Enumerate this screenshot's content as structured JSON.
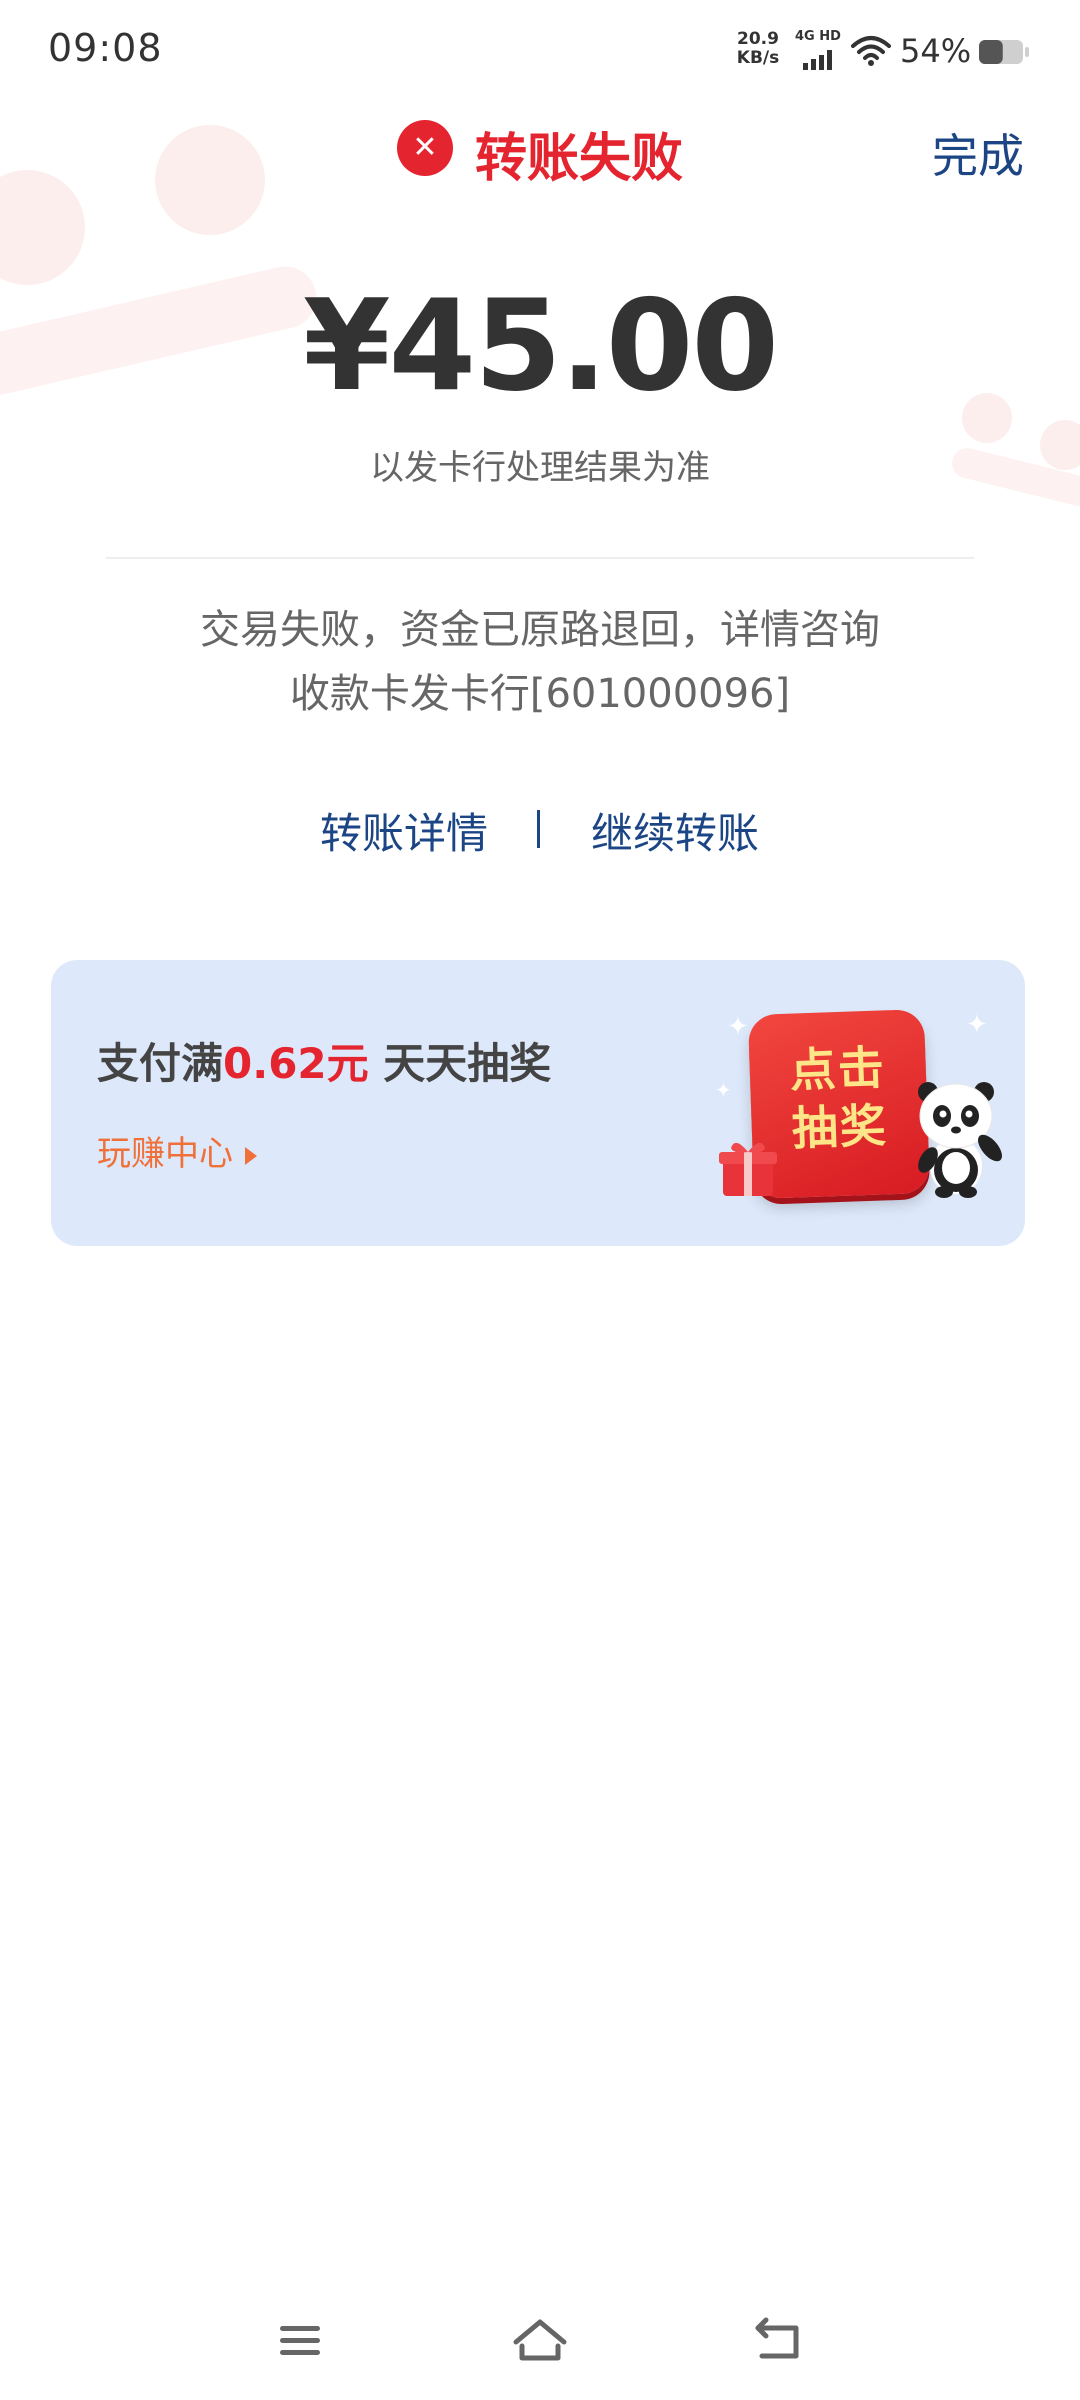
{
  "status_bar": {
    "time": "09:08",
    "net_speed_value": "20.9",
    "net_speed_unit": "KB/s",
    "network_label": "4G HD",
    "battery": "54%",
    "battery_level": 0.54,
    "icons": [
      "signal-icon",
      "wifi-icon",
      "battery-icon"
    ]
  },
  "header": {
    "status_icon": "close-icon",
    "title": "转账失败",
    "done_label": "完成"
  },
  "transfer": {
    "amount": "¥45.00",
    "amount_note": "以发卡行处理结果为准",
    "fail_message": "交易失败，资金已原路退回，详情咨询收款卡发卡行[601000096]"
  },
  "actions": {
    "details_label": "转账详情",
    "continue_label": "继续转账"
  },
  "promo": {
    "title_prefix": "支付满",
    "title_amount": "0.62元",
    "title_suffix": " 天天抽奖",
    "link_label": "玩赚中心",
    "button_line1": "点击",
    "button_line2": "抽奖",
    "icons": [
      "gift-icon",
      "panda-icon",
      "sparkle-icon"
    ]
  },
  "nav_bar": {
    "icons": [
      "menu-icon",
      "home-icon",
      "back-icon"
    ]
  },
  "colors": {
    "error_red": "#e4252f",
    "link_blue": "#1b4585",
    "promo_bg": "#dde9fa",
    "promo_orange": "#f0703a",
    "lottery_yellow": "#fde588"
  }
}
